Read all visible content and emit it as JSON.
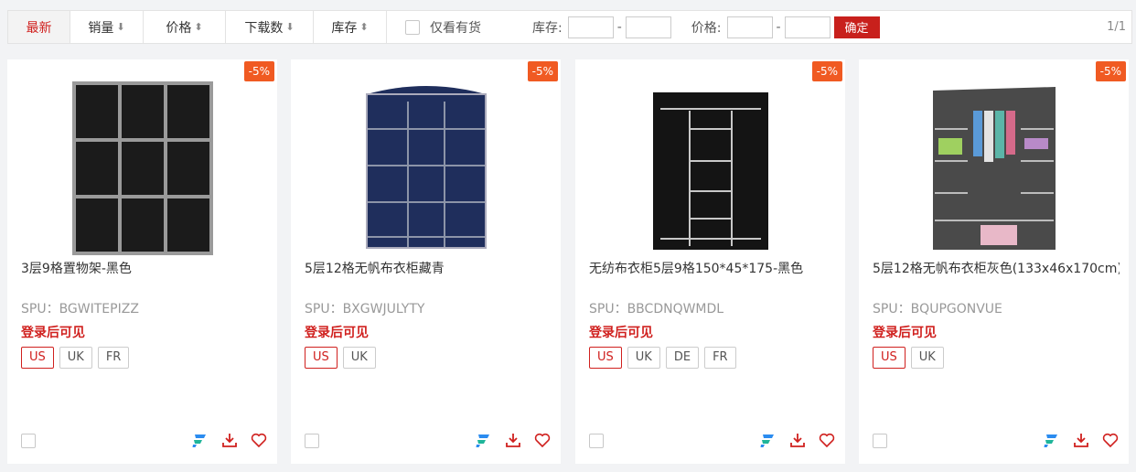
{
  "sortbar": {
    "latest": "最新",
    "sales": "销量",
    "price": "价格",
    "downloads": "下载数",
    "stock": "库存",
    "in_stock_only": "仅看有货",
    "stock_range_label": "库存:",
    "price_range_label": "价格:",
    "range_dash": "-",
    "confirm": "确定",
    "pagination": "1/1"
  },
  "products": [
    {
      "discount": "-5%",
      "title": "3层9格置物架-黑色",
      "spu": "SPU：BGWITEPIZZ",
      "price_text": "登录后可见",
      "markets": [
        "US",
        "UK",
        "FR"
      ]
    },
    {
      "discount": "-5%",
      "title": "5层12格无帆布衣柜藏青",
      "spu": "SPU：BXGWJULYTY",
      "price_text": "登录后可见",
      "markets": [
        "US",
        "UK"
      ]
    },
    {
      "discount": "-5%",
      "title": "无纺布衣柜5层9格150*45*175-黑色",
      "spu": "SPU：BBCDNQWMDL",
      "price_text": "登录后可见",
      "markets": [
        "US",
        "UK",
        "DE",
        "FR"
      ]
    },
    {
      "discount": "-5%",
      "title": "5层12格无帆布衣柜灰色(133x46x170cm)",
      "spu": "SPU：BQUPGONVUE",
      "price_text": "登录后可见",
      "markets": [
        "US",
        "UK"
      ]
    }
  ]
}
